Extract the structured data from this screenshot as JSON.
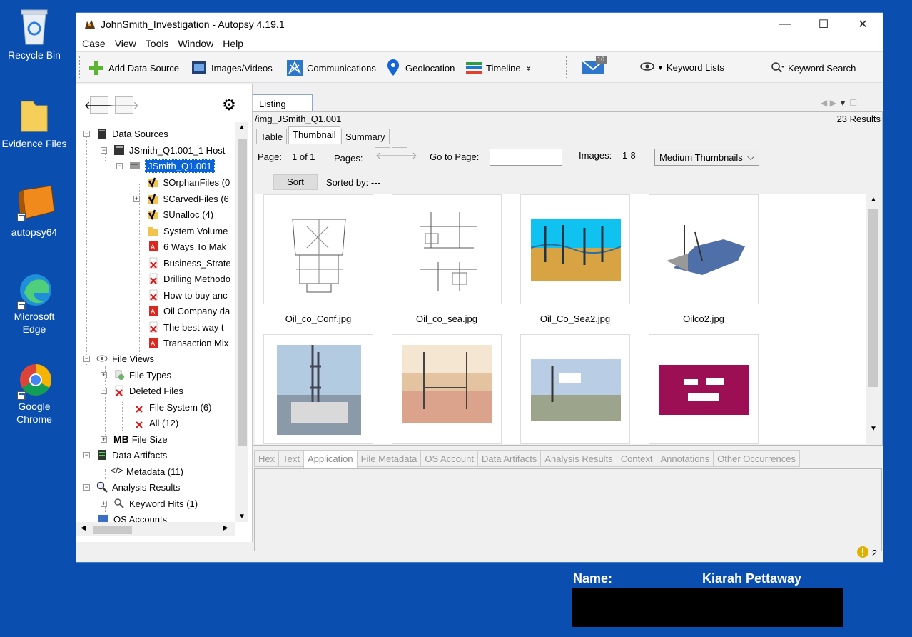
{
  "desktop": {
    "icons": [
      {
        "label": "Recycle Bin"
      },
      {
        "label": "Evidence Files"
      },
      {
        "label": "autopsy64"
      },
      {
        "label": "Microsoft\nEdge"
      },
      {
        "label": "Google\nChrome"
      }
    ]
  },
  "window": {
    "title": "JohnSmith_Investigation - Autopsy 4.19.1",
    "controls": {
      "minimize": "—",
      "maximize": "☐",
      "close": "✕"
    }
  },
  "menu": [
    "Case",
    "View",
    "Tools",
    "Window",
    "Help"
  ],
  "toolbar": {
    "add_data_source": "Add Data Source",
    "images_videos": "Images/Videos",
    "communications": "Communications",
    "geolocation": "Geolocation",
    "timeline": "Timeline",
    "more": "»",
    "messages_count": "16",
    "keyword_lists": "Keyword Lists",
    "keyword_search": "Keyword Search"
  },
  "tree": {
    "data_sources": "Data Sources",
    "host": "JSmith_Q1.001_1 Host",
    "image": "JSmith_Q1.001",
    "orphan": "$OrphanFiles (0",
    "carved": "$CarvedFiles (6",
    "unalloc": "$Unalloc (4)",
    "system_volume": "System Volume",
    "file1": "6 Ways To Mak",
    "file2": "Business_Strate",
    "file3": "Drilling Methodo",
    "file4": "How to buy anc",
    "file5": "Oil Company da",
    "file6": "The best way t",
    "file7": "Transaction Mix",
    "file_views": "File Views",
    "file_types": "File Types",
    "deleted_files": "Deleted Files",
    "file_system": "File System (6)",
    "all": "All (12)",
    "file_size_prefix": "MB",
    "file_size": "File Size",
    "data_artifacts": "Data Artifacts",
    "metadata": "Metadata (11)",
    "analysis_results": "Analysis Results",
    "keyword_hits": "Keyword Hits (1)",
    "os_accounts": "OS Accounts"
  },
  "listing": {
    "tab": "Listing",
    "path": "/img_JSmith_Q1.001",
    "results": "23  Results",
    "subtabs": [
      "Table",
      "Thumbnail",
      "Summary"
    ],
    "page_label": "Page:",
    "page_value": "1 of 1",
    "pages_label": "Pages:",
    "goto_label": "Go to Page:",
    "images_label": "Images:",
    "images_value": "1-8",
    "thumb_size": "Medium Thumbnails",
    "sort_button": "Sort",
    "sorted_by": "Sorted by: ---",
    "thumbnails": [
      "Oil_co_Conf.jpg",
      "Oil_co_sea.jpg",
      "Oil_Co_Sea2.jpg",
      "Oilco2.jpg"
    ]
  },
  "viewer": {
    "tabs": [
      "Hex",
      "Text",
      "Application",
      "File Metadata",
      "OS Account",
      "Data Artifacts",
      "Analysis Results",
      "Context",
      "Annotations",
      "Other Occurrences"
    ]
  },
  "status": {
    "notifications": "2"
  },
  "overlay": {
    "name_label": "Name:",
    "name_value": "Kiarah Pettaway"
  }
}
